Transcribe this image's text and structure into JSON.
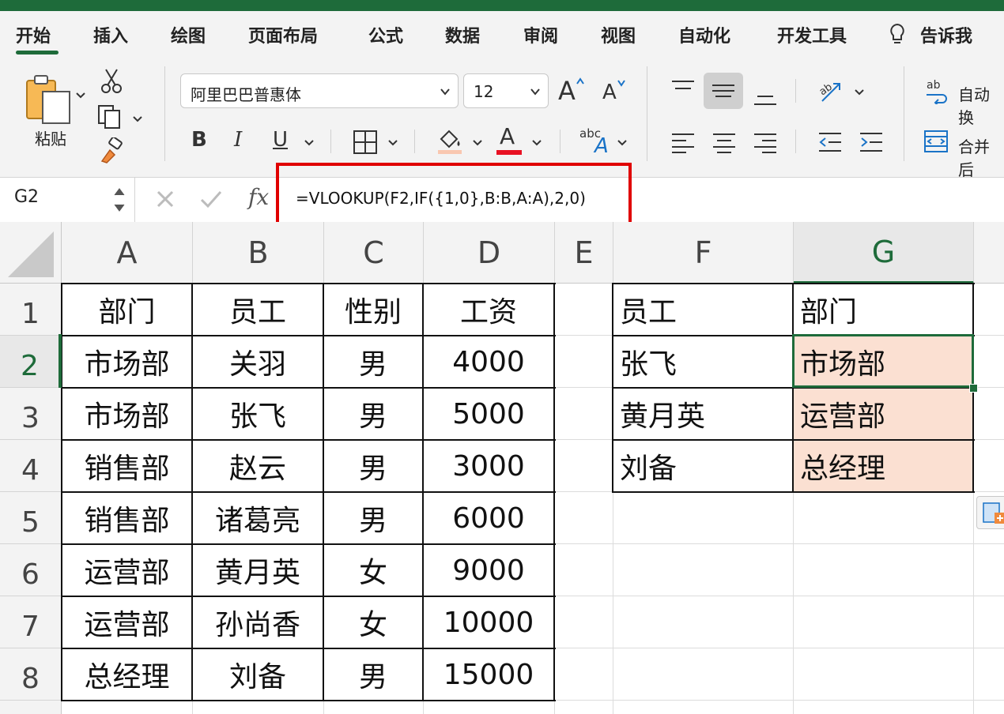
{
  "ribbon_tabs": [
    "开始",
    "插入",
    "绘图",
    "页面布局",
    "公式",
    "数据",
    "审阅",
    "视图",
    "自动化",
    "开发工具",
    "告诉我"
  ],
  "ribbon": {
    "paste_label": "粘贴",
    "font_name": "阿里巴巴普惠体",
    "font_size": "12",
    "bold": "B",
    "italic": "I",
    "underline": "U",
    "font_color_glyph": "A",
    "grow_font_glyph": "A",
    "shrink_font_glyph": "A",
    "orientation_glyph": "abc",
    "wrap_text_glyph": "ab",
    "wrap_text_label": "自动换",
    "merge_label": "合并后",
    "font_color_bar": "#e81123",
    "fill_color_bar": "#f9c7b0"
  },
  "formula_bar": {
    "name_box": "G2",
    "fx": "fx",
    "formula": "=VLOOKUP(F2,IF({1,0},B:B,A:A),2,0)"
  },
  "columns": [
    "A",
    "B",
    "C",
    "D",
    "E",
    "F",
    "G"
  ],
  "rows": [
    "1",
    "2",
    "3",
    "4",
    "5",
    "6",
    "7",
    "8"
  ],
  "table_main": {
    "headers": [
      "部门",
      "员工",
      "性别",
      "工资"
    ],
    "rows": [
      [
        "市场部",
        "关羽",
        "男",
        "4000"
      ],
      [
        "市场部",
        "张飞",
        "男",
        "5000"
      ],
      [
        "销售部",
        "赵云",
        "男",
        "3000"
      ],
      [
        "销售部",
        "诸葛亮",
        "男",
        "6000"
      ],
      [
        "运营部",
        "黄月英",
        "女",
        "9000"
      ],
      [
        "运营部",
        "孙尚香",
        "女",
        "10000"
      ],
      [
        "总经理",
        "刘备",
        "男",
        "15000"
      ]
    ]
  },
  "table_lookup": {
    "headers": [
      "员工",
      "部门"
    ],
    "rows": [
      [
        "张飞",
        "市场部"
      ],
      [
        "黄月英",
        "运营部"
      ],
      [
        "刘备",
        "总经理"
      ]
    ]
  },
  "colors": {
    "accent": "#1e6b3a",
    "result_fill": "#fbe0d2",
    "highlight_box": "#e00000"
  }
}
